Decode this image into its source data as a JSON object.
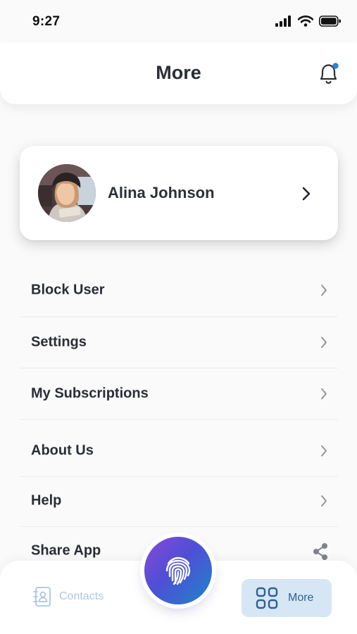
{
  "status_bar": {
    "time": "9:27"
  },
  "header": {
    "title": "More"
  },
  "profile": {
    "name": "Alina Johnson"
  },
  "menu": {
    "items": [
      {
        "label": "Block User"
      },
      {
        "label": "Settings"
      },
      {
        "label": "My Subscriptions"
      },
      {
        "label": "About Us"
      },
      {
        "label": "Help"
      },
      {
        "label": "Share App"
      }
    ]
  },
  "bottom_nav": {
    "contacts_label": "Contacts",
    "more_label": "More"
  },
  "icons": {
    "notification": "bell-icon",
    "chevron": "chevron-right-icon",
    "share": "share-icon",
    "contacts": "contact-book-icon",
    "more": "grid-icon",
    "fab": "fingerprint-icon"
  },
  "colors": {
    "accent_blue": "#2e5f96",
    "notification_dot": "#2f7fd6",
    "fab_gradient_start": "#8a47d8",
    "fab_gradient_end": "#1f84c8"
  }
}
